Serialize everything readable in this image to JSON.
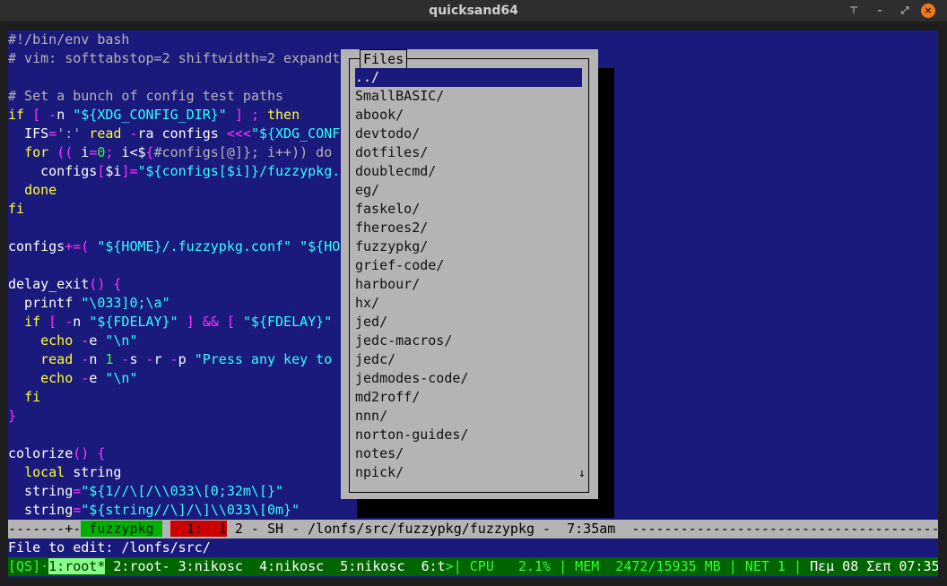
{
  "window": {
    "title": "quicksand64",
    "buttons": [
      "pin-icon",
      "minimize-icon",
      "maximize-icon",
      "close-icon"
    ]
  },
  "colors": {
    "background": "#1a197c",
    "dialog": "#b4b4b4",
    "tmux_bar": "#006400"
  },
  "editor": {
    "lines": [
      [
        [
          "#!/bin/env bash",
          "g"
        ]
      ],
      [
        [
          "# vim: softtabstop=2 shiftwidth=2 expandt",
          "g"
        ]
      ],
      [],
      [
        [
          "# Set a bunch of config test paths",
          "g"
        ]
      ],
      [
        [
          "if",
          "y"
        ],
        [
          " ",
          "w"
        ],
        [
          "[",
          "m"
        ],
        [
          " ",
          "w"
        ],
        [
          "-",
          "m"
        ],
        [
          "n ",
          "w"
        ],
        [
          "\"${XDG_CONFIG_DIR}\"",
          "c"
        ],
        [
          " ",
          "w"
        ],
        [
          "]",
          "m"
        ],
        [
          " ",
          "w"
        ],
        [
          ";",
          "m"
        ],
        [
          " ",
          "w"
        ],
        [
          "then",
          "y"
        ]
      ],
      [
        [
          "  IFS",
          "w"
        ],
        [
          "=",
          "m"
        ],
        [
          "':'",
          "g"
        ],
        [
          " ",
          "w"
        ],
        [
          "read",
          "y"
        ],
        [
          " ",
          "w"
        ],
        [
          "-",
          "m"
        ],
        [
          "ra configs ",
          "w"
        ],
        [
          "<<<",
          "m"
        ],
        [
          "\"${XDG_CONF",
          "c"
        ]
      ],
      [
        [
          "  ",
          "w"
        ],
        [
          "for",
          "y"
        ],
        [
          " ",
          "w"
        ],
        [
          "((",
          "m"
        ],
        [
          " i",
          "w"
        ],
        [
          "=",
          "m"
        ],
        [
          "0",
          "n"
        ],
        [
          ";",
          "m"
        ],
        [
          " i<$",
          "w"
        ],
        [
          "{",
          "m"
        ],
        [
          "#configs[@]}; i++)) do",
          "g"
        ]
      ],
      [
        [
          "    configs",
          "w"
        ],
        [
          "[",
          "m"
        ],
        [
          "$i",
          "w"
        ],
        [
          "]",
          "m"
        ],
        [
          "=",
          "m"
        ],
        [
          "\"${configs[$i]}/fuzzypkg.",
          "c"
        ]
      ],
      [
        [
          "  ",
          "w"
        ],
        [
          "done",
          "y"
        ]
      ],
      [
        [
          "fi",
          "y"
        ]
      ],
      [],
      [
        [
          "configs",
          "w"
        ],
        [
          "+=(",
          "m"
        ],
        [
          " ",
          "w"
        ],
        [
          "\"${HOME}/.fuzzypkg.conf\"",
          "c"
        ],
        [
          " ",
          "w"
        ],
        [
          "\"${HO",
          "c"
        ]
      ],
      [],
      [
        [
          "delay_exit",
          "w"
        ],
        [
          "()",
          "m"
        ],
        [
          " ",
          "w"
        ],
        [
          "{",
          "m"
        ]
      ],
      [
        [
          "  printf ",
          "w"
        ],
        [
          "\"\\033]0;\\a\"",
          "c"
        ]
      ],
      [
        [
          "  ",
          "w"
        ],
        [
          "if",
          "y"
        ],
        [
          " ",
          "w"
        ],
        [
          "[",
          "m"
        ],
        [
          " ",
          "w"
        ],
        [
          "-",
          "m"
        ],
        [
          "n ",
          "w"
        ],
        [
          "\"${FDELAY}\"",
          "c"
        ],
        [
          " ",
          "w"
        ],
        [
          "]",
          "m"
        ],
        [
          " ",
          "w"
        ],
        [
          "&&",
          "m"
        ],
        [
          " ",
          "w"
        ],
        [
          "[",
          "m"
        ],
        [
          " ",
          "w"
        ],
        [
          "\"${FDELAY}\"",
          "c"
        ]
      ],
      [
        [
          "    ",
          "w"
        ],
        [
          "echo",
          "y"
        ],
        [
          " ",
          "w"
        ],
        [
          "-",
          "m"
        ],
        [
          "e ",
          "w"
        ],
        [
          "\"\\n\"",
          "c"
        ]
      ],
      [
        [
          "    ",
          "w"
        ],
        [
          "read",
          "y"
        ],
        [
          " ",
          "w"
        ],
        [
          "-",
          "m"
        ],
        [
          "n ",
          "w"
        ],
        [
          "1",
          "n"
        ],
        [
          " ",
          "w"
        ],
        [
          "-",
          "m"
        ],
        [
          "s ",
          "w"
        ],
        [
          "-",
          "m"
        ],
        [
          "r ",
          "w"
        ],
        [
          "-",
          "m"
        ],
        [
          "p ",
          "w"
        ],
        [
          "\"Press any key to",
          "c"
        ]
      ],
      [
        [
          "    ",
          "w"
        ],
        [
          "echo",
          "y"
        ],
        [
          " ",
          "w"
        ],
        [
          "-",
          "m"
        ],
        [
          "e ",
          "w"
        ],
        [
          "\"\\n\"",
          "c"
        ]
      ],
      [
        [
          "  ",
          "w"
        ],
        [
          "fi",
          "y"
        ]
      ],
      [
        [
          "}",
          "m"
        ]
      ],
      [],
      [
        [
          "colorize",
          "w"
        ],
        [
          "()",
          "m"
        ],
        [
          " ",
          "w"
        ],
        [
          "{",
          "m"
        ]
      ],
      [
        [
          "  ",
          "w"
        ],
        [
          "local",
          "y"
        ],
        [
          " string",
          "w"
        ]
      ],
      [
        [
          "  string",
          "w"
        ],
        [
          "=",
          "m"
        ],
        [
          "\"${1//\\[/\\\\033\\[0;32m\\[}\"",
          "c"
        ]
      ],
      [
        [
          "  string",
          "w"
        ],
        [
          "=",
          "m"
        ],
        [
          "\"${string//\\]/\\]\\\\033\\[0m}\"",
          "c"
        ]
      ]
    ]
  },
  "file_dialog": {
    "title": "Files",
    "selected_index": 0,
    "items": [
      "../",
      "SmallBASIC/",
      "abook/",
      "devtodo/",
      "dotfiles/",
      "doublecmd/",
      "eg/",
      "faskelo/",
      "fheroes2/",
      "fuzzypkg/",
      "grief-code/",
      "harbour/",
      "hx/",
      "jed/",
      "jedc-macros/",
      "jedc/",
      "jedmodes-code/",
      "md2roff/",
      "nnn/",
      "norton-guides/",
      "notes/",
      "npick/"
    ],
    "scroll_arrow": "↓"
  },
  "status_line": {
    "left": "-------+-",
    "buffer": " fuzzypkg ",
    "position": "  1:  1",
    "info": " 2 - SH - /lonfs/src/fuzzypkg/fuzzypkg -  7:35am  ",
    "fill": "-------------------------------------------------------------------"
  },
  "prompt": {
    "text": "File to edit: /lonfs/src/"
  },
  "tmux": {
    "session": "[QS]",
    "sep": "·",
    "active_window": "1:root*",
    "windows": " 2:root- 3:nikosc  4:nikosc  5:nikosc  6:t",
    "stats": ">| CPU   2.1% | MEM  2472/15935 MB | NET 1 | ",
    "clock": "Πεμ 08 Σεπ 07:35"
  }
}
